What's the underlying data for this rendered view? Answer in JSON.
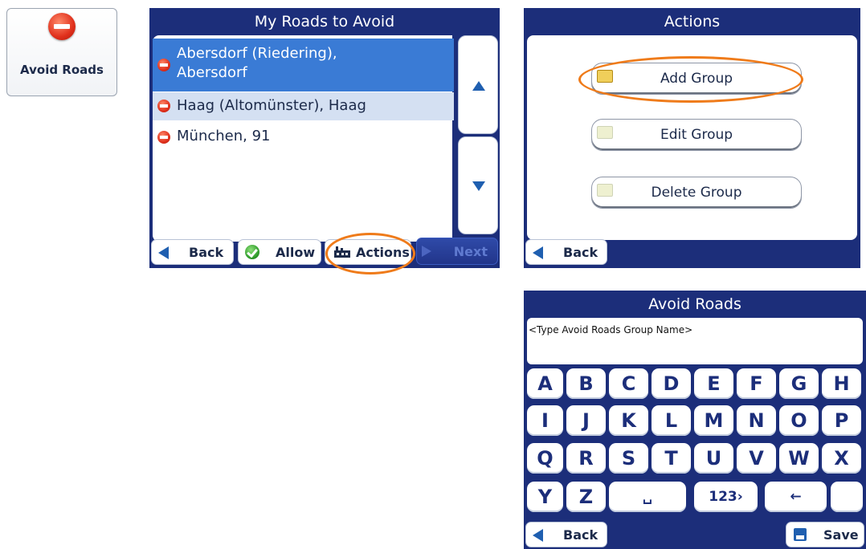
{
  "tile": {
    "label": "Avoid Roads",
    "icon": "no-entry-icon"
  },
  "roads_panel": {
    "title": "My Roads to Avoid",
    "items": [
      {
        "line1": "Abersdorf (Riedering),",
        "line2": "Abersdorf",
        "state": "selected"
      },
      {
        "line1": "Haag (Altomünster), Haag",
        "state": "highlighted"
      },
      {
        "line1": "München, 91",
        "state": "normal"
      }
    ],
    "buttons": {
      "back": "Back",
      "allow": "Allow",
      "actions": "Actions",
      "next": "Next"
    }
  },
  "actions_panel": {
    "title": "Actions",
    "items": [
      {
        "label": "Add Group"
      },
      {
        "label": "Edit Group"
      },
      {
        "label": "Delete Group"
      }
    ],
    "back": "Back"
  },
  "keyboard_panel": {
    "title": "Avoid Roads",
    "placeholder": "<Type Avoid Roads Group Name>",
    "rows": [
      [
        "A",
        "B",
        "C",
        "D",
        "E",
        "F",
        "G",
        "H"
      ],
      [
        "I",
        "J",
        "K",
        "L",
        "M",
        "N",
        "O",
        "P"
      ],
      [
        "Q",
        "R",
        "S",
        "T",
        "U",
        "V",
        "W",
        "X"
      ]
    ],
    "last_row": {
      "y": "Y",
      "z": "Z",
      "space": "␣",
      "numbers": "123›",
      "backspace": "←"
    },
    "back": "Back",
    "save": "Save"
  },
  "colors": {
    "panel": "#1c2e7a",
    "selected": "#3a7bd5",
    "highlight": "#d4e0f2",
    "callout": "#ef7b1a"
  }
}
